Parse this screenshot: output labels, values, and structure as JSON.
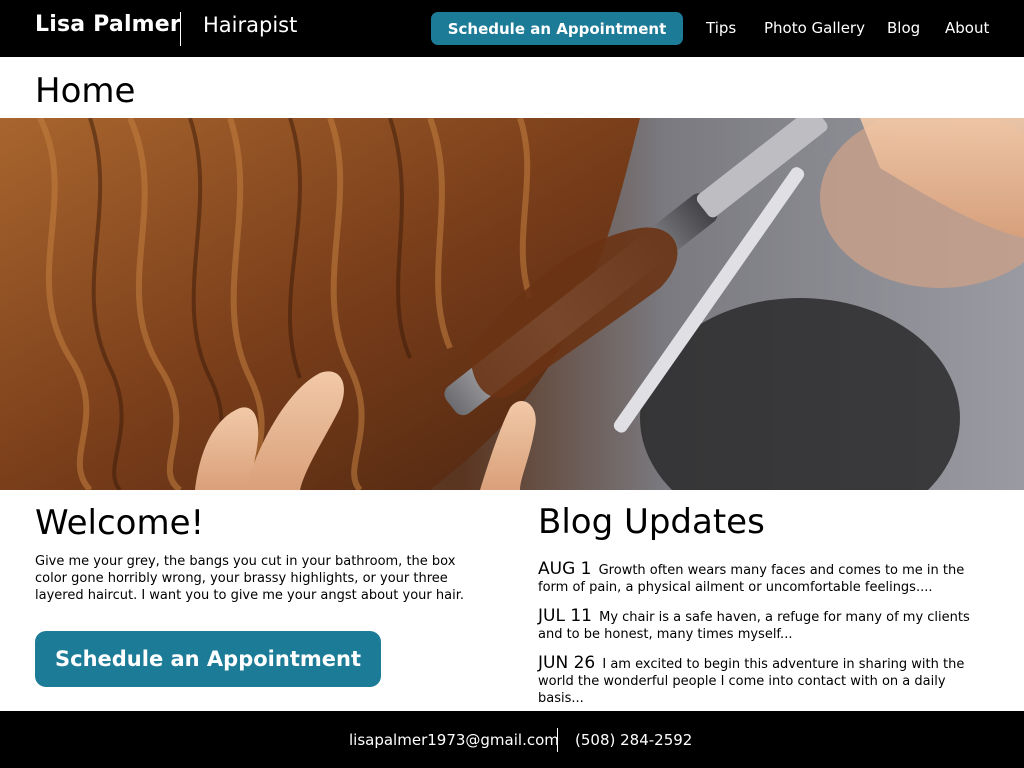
{
  "header": {
    "brand_name": "Lisa Palmer",
    "brand_title": "Hairapist",
    "cta_label": "Schedule an Appointment",
    "nav": [
      {
        "label": "Tips"
      },
      {
        "label": "Photo Gallery"
      },
      {
        "label": "Blog"
      },
      {
        "label": "About"
      }
    ]
  },
  "page": {
    "title": "Home"
  },
  "hero": {
    "image_description": "hero-photo-curling-iron"
  },
  "welcome": {
    "heading": "Welcome!",
    "text": "Give me your grey, the bangs you cut in your bathroom, the box color gone horribly wrong, your brassy highlights, or your three layered haircut. I want you to give me your angst about your hair.",
    "cta_label": "Schedule an Appointment"
  },
  "blog": {
    "heading": "Blog Updates",
    "entries": [
      {
        "date": "AUG 1",
        "excerpt": "Growth often wears many faces and comes to me in the form of pain, a physical ailment or uncomfortable feelings...."
      },
      {
        "date": "JUL 11",
        "excerpt": "My chair is a safe haven, a refuge for many of my clients and to be honest, many times myself..."
      },
      {
        "date": "JUN 26",
        "excerpt": "I am excited to begin this adventure in sharing with the world the wonderful people I come into contact with on a daily basis..."
      }
    ]
  },
  "footer": {
    "email": "lisapalmer1973@gmail.com",
    "phone": "(508) 284-2592"
  },
  "colors": {
    "accent": "#1c7b97",
    "bar": "#000000"
  }
}
